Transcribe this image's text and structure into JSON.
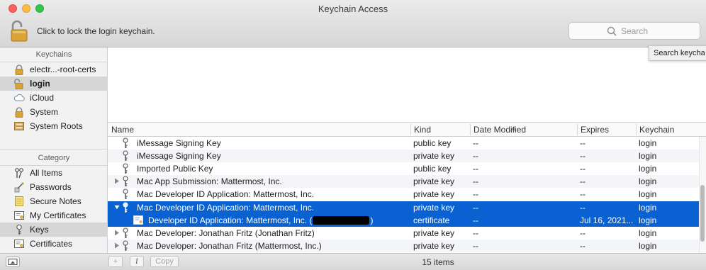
{
  "window": {
    "title": "Keychain Access"
  },
  "toolbar": {
    "lock_text": "Click to lock the login keychain.",
    "search_placeholder": "Search",
    "tooltip": "Search keycha"
  },
  "sidebar": {
    "keychains_header": "Keychains",
    "keychains": [
      {
        "label": "electr...-root-certs",
        "icon": "lock-icon"
      },
      {
        "label": "login",
        "icon": "unlock-icon",
        "selected": true
      },
      {
        "label": "iCloud",
        "icon": "cloud-icon"
      },
      {
        "label": "System",
        "icon": "lock-icon"
      },
      {
        "label": "System Roots",
        "icon": "cabinet-icon"
      }
    ],
    "category_header": "Category",
    "categories": [
      {
        "label": "All Items",
        "icon": "all-items-icon"
      },
      {
        "label": "Passwords",
        "icon": "password-icon"
      },
      {
        "label": "Secure Notes",
        "icon": "note-icon"
      },
      {
        "label": "My Certificates",
        "icon": "certificate-icon"
      },
      {
        "label": "Keys",
        "icon": "key-icon",
        "selected": true
      },
      {
        "label": "Certificates",
        "icon": "certificate-icon"
      }
    ]
  },
  "table": {
    "columns": {
      "name": "Name",
      "kind": "Kind",
      "date_modified": "Date Modified",
      "expires": "Expires",
      "keychain": "Keychain"
    },
    "rows": [
      {
        "name": "iMessage Signing Key",
        "kind": "public key",
        "date": "--",
        "expires": "--",
        "keychain": "login"
      },
      {
        "name": "iMessage Signing Key",
        "kind": "private key",
        "date": "--",
        "expires": "--",
        "keychain": "login"
      },
      {
        "name": "Imported Public Key",
        "kind": "public key",
        "date": "--",
        "expires": "--",
        "keychain": "login"
      },
      {
        "name": "Mac App Submission: Mattermost, Inc.",
        "kind": "private key",
        "date": "--",
        "expires": "--",
        "keychain": "login"
      },
      {
        "name": "Mac Developer ID Application: Mattermost, Inc.",
        "kind": "private key",
        "date": "--",
        "expires": "--",
        "keychain": "login"
      },
      {
        "name": "Mac Developer ID Application: Mattermost, Inc.",
        "kind": "private key",
        "date": "--",
        "expires": "--",
        "keychain": "login"
      },
      {
        "name_prefix": "Developer ID Application: Mattermost, Inc. (",
        "name_suffix": ")",
        "kind": "certificate",
        "date": "--",
        "expires": "Jul 16, 2021...",
        "keychain": "login"
      },
      {
        "name": "Mac Developer: Jonathan Fritz (Jonathan Fritz)",
        "kind": "private key",
        "date": "--",
        "expires": "--",
        "keychain": "login"
      },
      {
        "name": "Mac Developer: Jonathan Fritz (Mattermost, Inc.)",
        "kind": "private key",
        "date": "--",
        "expires": "--",
        "keychain": "login"
      }
    ]
  },
  "bottombar": {
    "add_label": "+",
    "info_label": "i",
    "copy_label": "Copy",
    "item_count": "15 items"
  },
  "colors": {
    "selection": "#0a61d1",
    "lock_gold": "#d9a33a"
  }
}
